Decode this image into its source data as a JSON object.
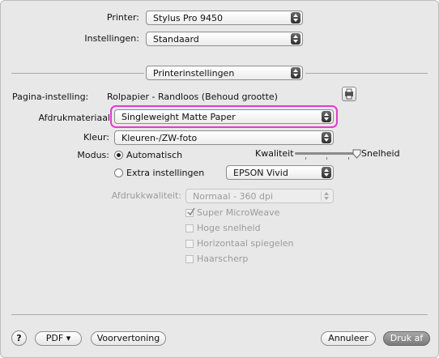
{
  "printer": {
    "label": "Printer:",
    "value": "Stylus Pro 9450"
  },
  "presets": {
    "label": "Instellingen:",
    "value": "Standaard"
  },
  "panel_select": {
    "value": "Printerinstellingen"
  },
  "page_setup": {
    "label": "Pagina-instelling:",
    "value": "Rolpapier - Randloos (Behoud grootte)"
  },
  "media": {
    "label": "Afdrukmateriaal",
    "value": "Singleweight Matte Paper",
    "highlight_color": "#e23bd0"
  },
  "color": {
    "label": "Kleur:",
    "value": "Kleuren-/ZW-foto"
  },
  "mode": {
    "label": "Modus:",
    "auto_label": "Automatisch",
    "advanced_label": "Extra instellingen",
    "selected": "Automatisch",
    "quality_label": "Kwaliteit",
    "speed_label": "Snelheid",
    "slider_value": 1.0,
    "color_mode": "EPSON Vivid"
  },
  "print_quality": {
    "label": "Afdrukkwaliteit:",
    "value": "Normaal - 360 dpi"
  },
  "options": [
    {
      "label": "Super MicroWeave",
      "checked": true
    },
    {
      "label": "Hoge snelheid",
      "checked": false
    },
    {
      "label": "Horizontaal spiegelen",
      "checked": false
    },
    {
      "label": "Haarscherp",
      "checked": false
    }
  ],
  "footer": {
    "help": "?",
    "pdf": "PDF ▾",
    "preview": "Voorvertoning",
    "cancel": "Annuleer",
    "print": "Druk af"
  },
  "icons": {
    "help": "question-mark",
    "page_setup_info": "printer-info-icon",
    "check": "checkmark"
  }
}
